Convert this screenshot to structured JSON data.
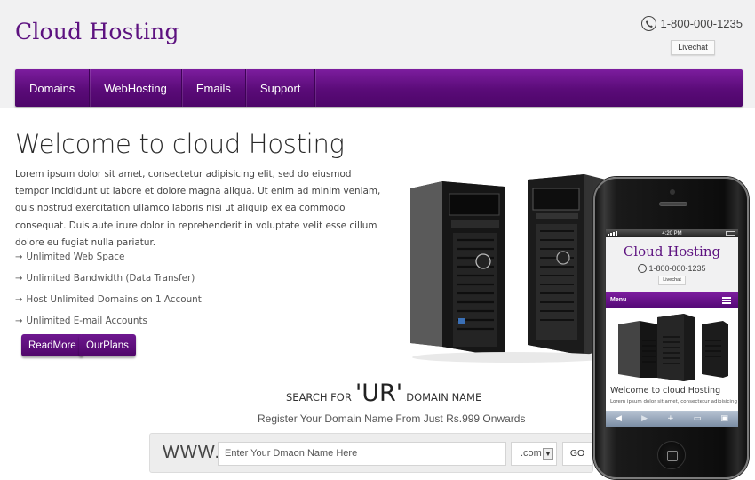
{
  "header": {
    "logo": "Cloud Hosting",
    "phone": "1-800-000-1235",
    "livechat": "Livechat"
  },
  "nav": {
    "items": [
      "Domains",
      "WebHosting",
      "Emails",
      "Support"
    ]
  },
  "main": {
    "title": "Welcome to cloud Hosting",
    "intro": "Lorem ipsum dolor sit amet, consectetur adipisicing elit, sed do eiusmod tempor incididunt ut labore et dolore magna aliqua. Ut enim ad minim veniam, quis nostrud exercitation ullamco laboris nisi ut aliquip ex ea commodo consequat. Duis aute irure dolor in reprehenderit in voluptate velit esse cillum dolore eu fugiat nulla pariatur.",
    "features": [
      "Unlimited Web Space",
      "Unlimited Bandwidth (Data Transfer)",
      "Host Unlimited Domains on 1 Account",
      "Unlimited E-mail Accounts"
    ],
    "readmore": "ReadMore",
    "ourplans": "OurPlans"
  },
  "search": {
    "title_prefix": "SEARCH FOR",
    "title_big": "'UR'",
    "title_suffix": "DOMAIN NAME",
    "register": "Register Your Domain Name From Just Rs.999 Onwards",
    "www": "WWW.",
    "placeholder": "Enter Your Dmaon Name Here",
    "tld": ".com",
    "go": "GO"
  },
  "mobile": {
    "time": "4:20 PM",
    "logo": "Cloud Hosting",
    "phone": "1-800-000-1235",
    "livechat": "Livechat",
    "menu": "Menu",
    "welcome": "Welcome to cloud Hosting",
    "lorem": "Lorem ipsum dolor sit amet, consectetur adipisicing"
  },
  "colors": {
    "brand": "#5d1280",
    "nav_top": "#7c1d9e",
    "nav_bottom": "#4d0569",
    "header_bg": "#f1f1f2"
  }
}
